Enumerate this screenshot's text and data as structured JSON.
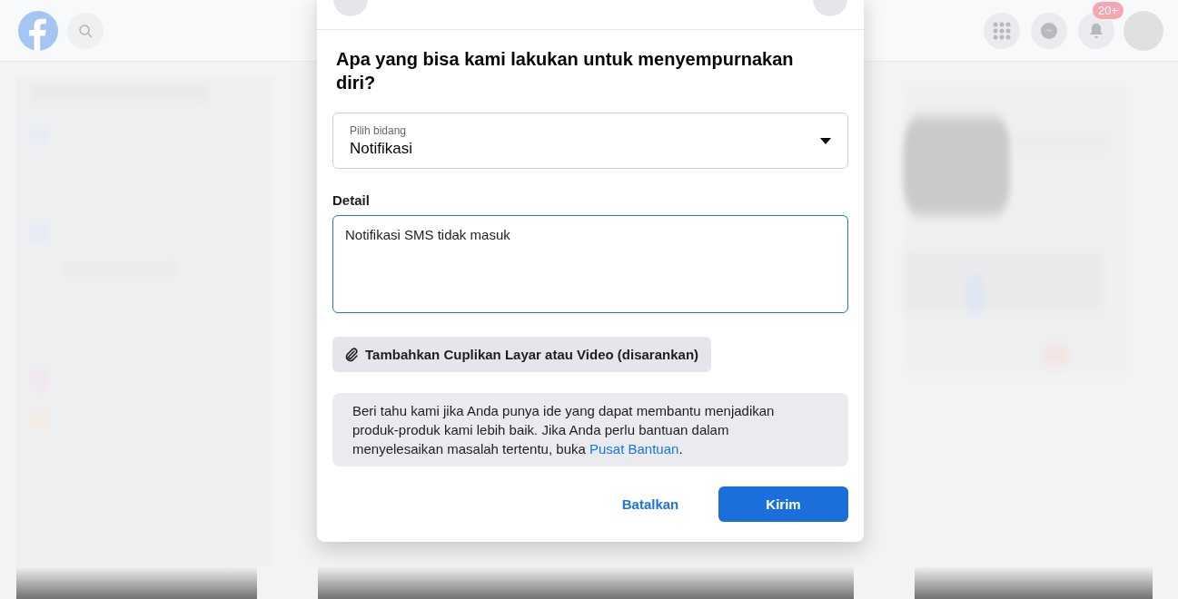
{
  "top_bar": {
    "notification_badge": "20+"
  },
  "dialog": {
    "heading": "Apa yang bisa kami lakukan untuk menyempurnakan diri?",
    "area_select": {
      "label": "Pilih bidang",
      "value": "Notifikasi"
    },
    "detail": {
      "label": "Detail",
      "value": "Notifikasi SMS tidak masuk",
      "focused": true
    },
    "attach_button": "Tambahkan Cuplikan Layar atau Video (disarankan)",
    "info": {
      "text": "Beri tahu kami jika Anda punya ide yang dapat membantu menjadikan produk-produk kami lebih baik. Jika Anda perlu bantuan dalam menyelesaikan masalah tertentu, buka ",
      "link": "Pusat Bantuan",
      "after": "."
    },
    "buttons": [
      {
        "label": "Batalkan",
        "kind": "secondary"
      },
      {
        "label": "Kirim",
        "kind": "primary"
      }
    ]
  }
}
